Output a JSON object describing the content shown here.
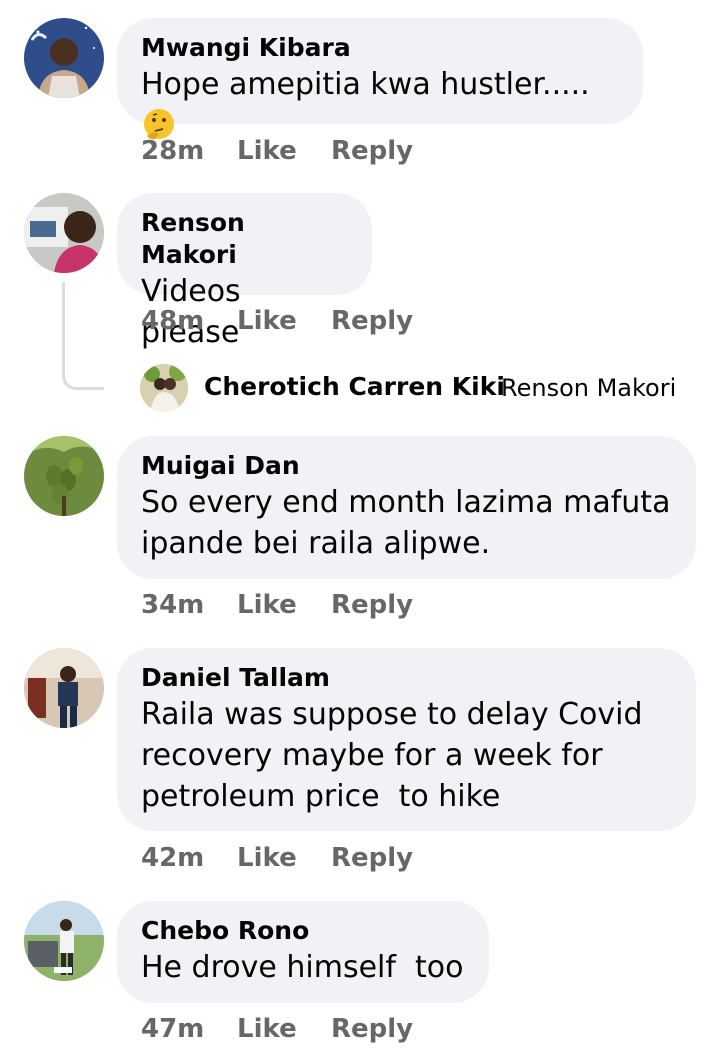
{
  "comments": [
    {
      "name": "Mwangi Kibara",
      "text": "Hope amepitia kwa hustler.....",
      "emoji": "thinking-face-emoji",
      "time": "28m",
      "like": "Like",
      "reply": "Reply"
    },
    {
      "name": "Renson Makori",
      "text": "Videos please",
      "time": "48m",
      "like": "Like",
      "reply": "Reply",
      "reply_preview": {
        "name": "Cherotich Carren Kiki",
        "replying_to": "Renson Makori"
      }
    },
    {
      "name": "Muigai Dan",
      "text": "So every end month lazima mafuta\nipande bei raila alipwe.",
      "time": "34m",
      "like": "Like",
      "reply": "Reply"
    },
    {
      "name": "Daniel Tallam",
      "text": "Raila was suppose to delay Covid\nrecovery maybe for a week for\npetroleum price  to hike",
      "time": "42m",
      "like": "Like",
      "reply": "Reply"
    },
    {
      "name": "Chebo Rono",
      "text": "He drove himself  too",
      "time": "47m",
      "like": "Like",
      "reply": "Reply"
    }
  ],
  "colors": {
    "bubble": "#f0f2f5",
    "meta": "#65676b",
    "text": "#050505",
    "thread_line": "#d9dce1"
  }
}
